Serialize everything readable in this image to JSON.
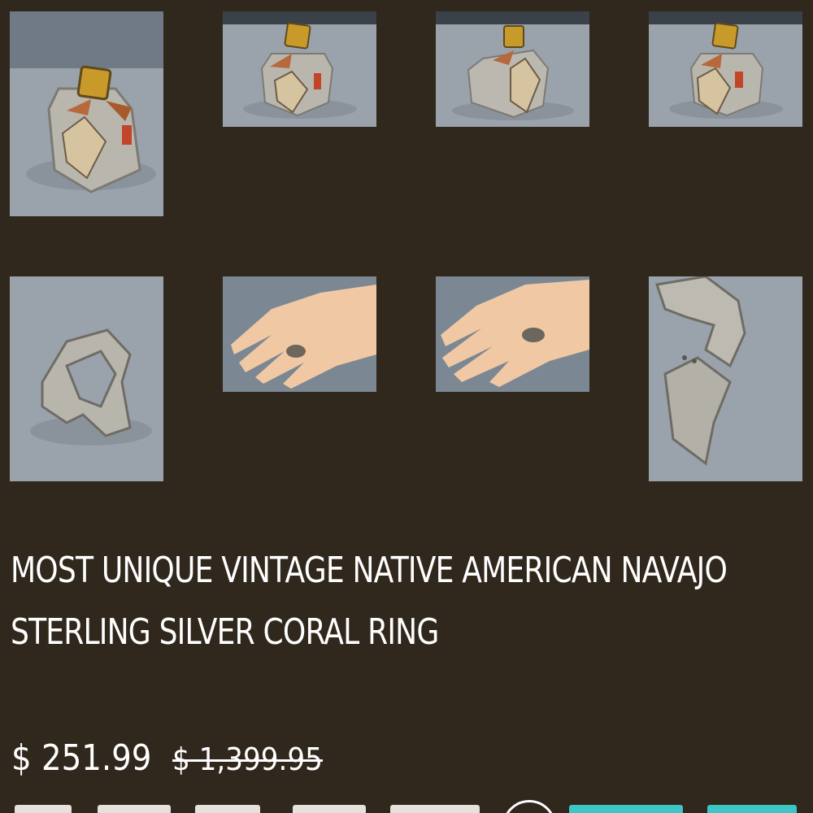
{
  "product": {
    "title": "MOST UNIQUE VINTAGE NATIVE AMERICAN NAVAJO STERLING SILVER CORAL RING",
    "sale_price": "$ 251.99",
    "regular_price": "$ 1,399.95"
  },
  "gallery": {
    "thumbnails": [
      {
        "icon": "ring-front-photo"
      },
      {
        "icon": "ring-front-photo"
      },
      {
        "icon": "ring-side-photo"
      },
      {
        "icon": "ring-front-photo"
      },
      {
        "icon": "ring-back-photo"
      },
      {
        "icon": "ring-on-hand-photo"
      },
      {
        "icon": "ring-on-hand-photo"
      },
      {
        "icon": "ring-hallmark-photo"
      }
    ]
  },
  "colors": {
    "background": "#30271d",
    "text": "#ffffff",
    "photo_backdrop": "#9aa3ab",
    "accent_link": "#3cc6c6"
  }
}
